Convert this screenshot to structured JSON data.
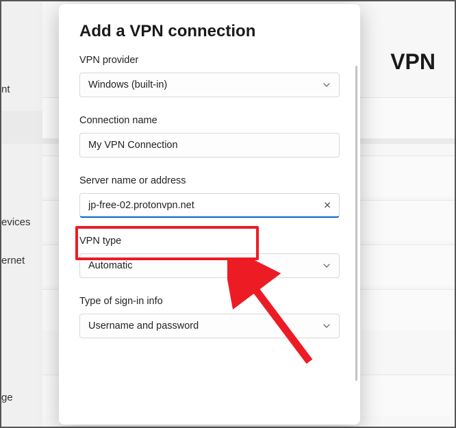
{
  "background": {
    "header_title": "VPN",
    "side_items": {
      "nt": "nt",
      "evices": "evices",
      "ernet": "ernet",
      "ge": "ge"
    }
  },
  "dialog": {
    "title": "Add a VPN connection",
    "fields": {
      "provider": {
        "label": "VPN provider",
        "value": "Windows (built-in)"
      },
      "conn_name": {
        "label": "Connection name",
        "value": "My VPN Connection"
      },
      "server": {
        "label": "Server name or address",
        "value": "jp-free-02.protonvpn.net"
      },
      "vpn_type": {
        "label": "VPN type",
        "value": "Automatic"
      },
      "signin": {
        "label": "Type of sign-in info",
        "value": "Username and password"
      }
    }
  },
  "annotations": {
    "highlight_color": "#ed1c24"
  }
}
